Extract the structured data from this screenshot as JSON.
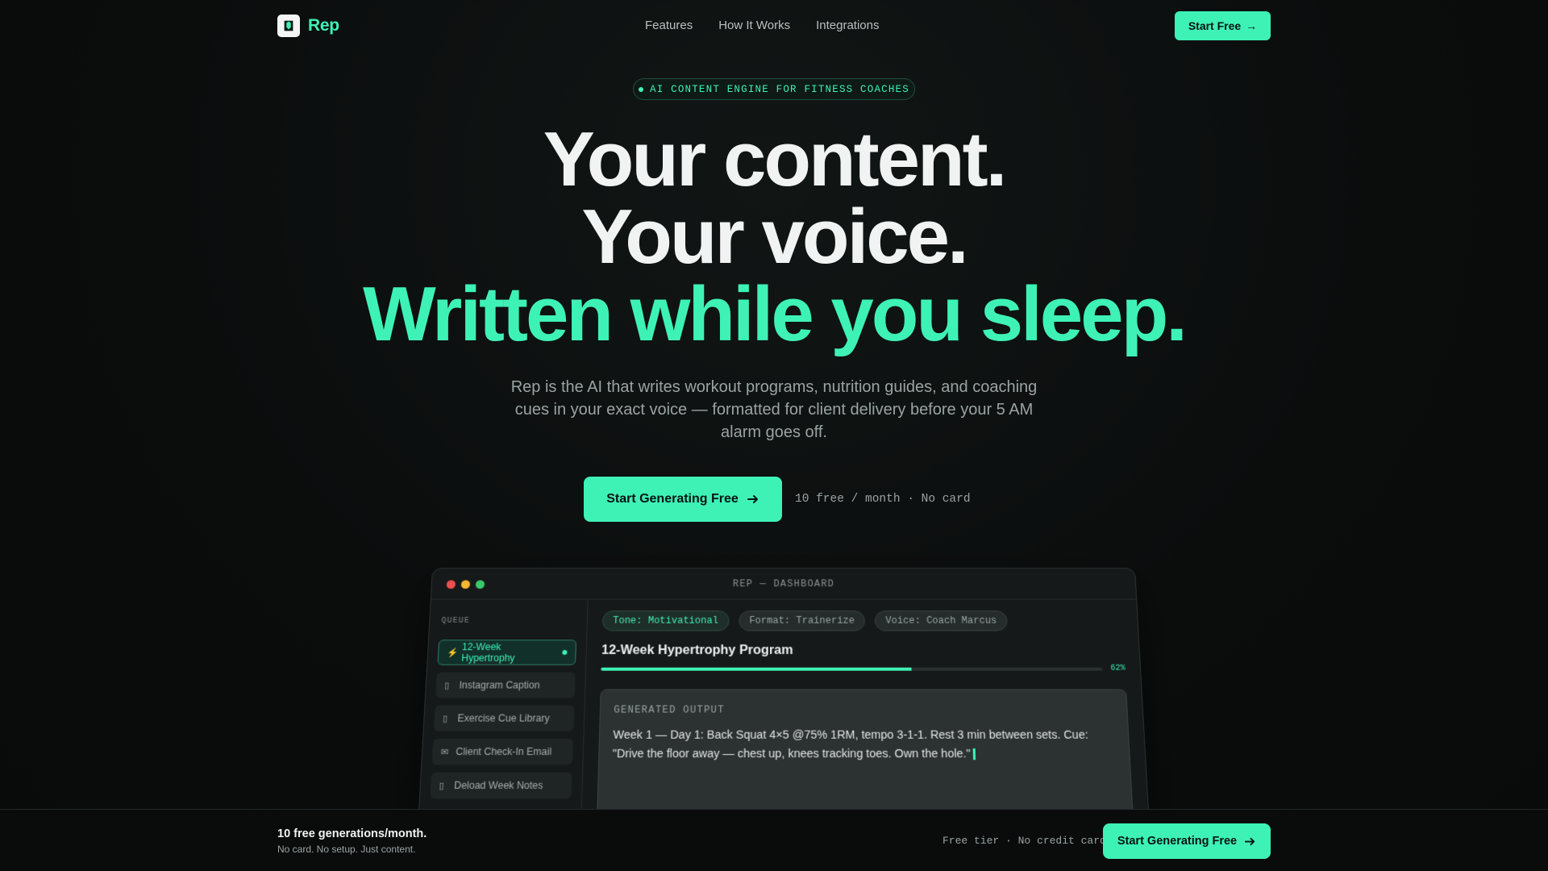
{
  "nav": {
    "brand": "Rep",
    "links": [
      "Features",
      "How It Works",
      "Integrations"
    ],
    "cta": "Start Free",
    "cta_arrow": "→"
  },
  "hero": {
    "badge": "AI CONTENT ENGINE FOR FITNESS COACHES",
    "headline": [
      "Your content.",
      "Your voice.",
      "Written while you sleep."
    ],
    "subtext": "Rep is the AI that writes workout programs, nutrition guides, and coaching cues in your exact voice — formatted for client delivery before your 5 AM alarm goes off.",
    "cta": "Start Generating Free",
    "cta_note": "10 free / month · No card"
  },
  "dashboard": {
    "title": "REP — DASHBOARD",
    "queue_label": "QUEUE",
    "queue": [
      {
        "icon": "⚡",
        "label": "12-Week Hypertrophy",
        "active": true
      },
      {
        "icon": "▯",
        "label": "Instagram Caption",
        "active": false
      },
      {
        "icon": "▯",
        "label": "Exercise Cue Library",
        "active": false
      },
      {
        "icon": "✉",
        "label": "Client Check-In Email",
        "active": false
      },
      {
        "icon": "▯",
        "label": "Deload Week Notes",
        "active": false
      }
    ],
    "chips": [
      "Tone: Motivational",
      "Format: Trainerize",
      "Voice: Coach Marcus"
    ],
    "doc_title": "12-Week Hypertrophy Program",
    "progress": 0.62,
    "progress_label": "62%",
    "output_label": "GENERATED OUTPUT",
    "output_text": "Week 1 — Day 1: Back Squat 4×5 @75% 1RM, tempo 3-1-1. Rest 3 min between sets. Cue: \"Drive the floor away — chest up, knees tracking toes. Own the hole.\""
  },
  "bottom_bar": {
    "title": "10 free generations/month.",
    "subtitle": "No card. No setup. Just content.",
    "note": "Free tier · No credit card",
    "cta": "Start Generating Free"
  },
  "colors": {
    "accent": "#3ef2b6",
    "background": "#0b0d0d"
  }
}
